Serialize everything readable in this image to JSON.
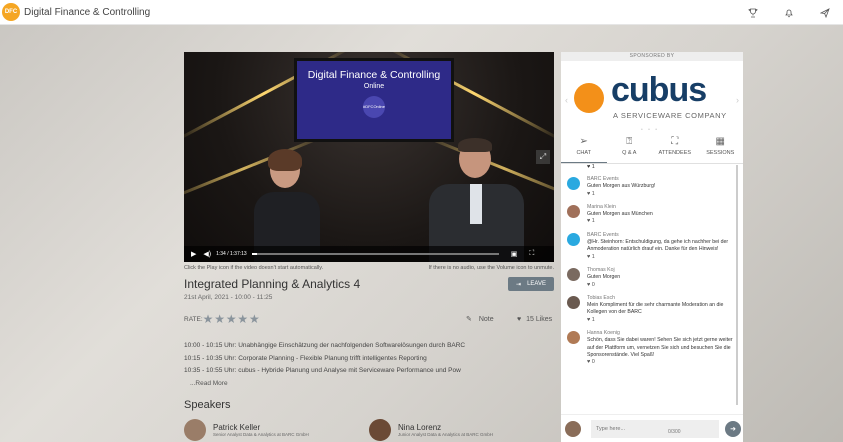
{
  "app": {
    "title": "Digital Finance & Controlling",
    "logo_text": "DFC"
  },
  "top_icons": [
    "trophy-icon",
    "bell-icon",
    "paper-plane-icon"
  ],
  "video": {
    "screen_title": "Digital Finance & Controlling",
    "screen_subtitle": "Online",
    "screen_tag": "#DFCOnline",
    "time": "1:34 / 1:37:13"
  },
  "hints": {
    "play": "Click the Play icon if the video doesn't start automatically.",
    "audio": "If there is no audio, use the Volume icon to unmute."
  },
  "session": {
    "title": "Integrated Planning & Analytics 4",
    "date": "21st April, 2021 - 10:00 - 11:25",
    "leave_label": "LEAVE",
    "rate_label": "RATE:",
    "stars": [
      "★",
      "★",
      "★",
      "★",
      "★"
    ],
    "note_label": "Note",
    "likes_label": "15 Likes"
  },
  "agenda": [
    "10:00 - 10:15 Uhr: Unabhängige Einschätzung der nachfolgenden Softwarelösungen durch BARC",
    "10:15 - 10:35 Uhr: Corporate Planning - Flexible Planung trifft intelligentes Reporting",
    "10:35 - 10:55 Uhr: cubus - Hybride Planung und Analyse mit Serviceware Performance und Pow"
  ],
  "read_more": "...Read More",
  "speakers": {
    "heading": "Speakers",
    "items": [
      {
        "name": "Patrick Keller",
        "role": "Senior Analyst Data & Analytics at BARC GmbH"
      },
      {
        "name": "Nina Lorenz",
        "role": "Junior Analyst Data & Analytics at BARC GmbH"
      }
    ]
  },
  "sponsor": {
    "label": "SPONSORED BY",
    "brand": "cubus",
    "subtitle": "A SERVICEWARE COMPANY",
    "dots": "• • •"
  },
  "tabs": [
    {
      "label": "CHAT",
      "icon": "paper-plane-icon"
    },
    {
      "label": "Q & A",
      "icon": "question-icon"
    },
    {
      "label": "ATTENDEES",
      "icon": "attendees-icon"
    },
    {
      "label": "SESSIONS",
      "icon": "calendar-icon"
    }
  ],
  "chat": {
    "first_like": "♥ 1",
    "messages": [
      {
        "name": "BARC Events",
        "text": "Guten Morgen aus Würzburg!",
        "likes": "♥ 1",
        "avatar_color": "#2aa9e0"
      },
      {
        "name": "Marina Klein",
        "text": "Guten Morgen aus München",
        "likes": "♥ 1",
        "avatar_color": "#a0705a"
      },
      {
        "name": "BARC Events",
        "text": "@Hr. Steinhorn: Entschuldigung, da gehe ich nachher bei der Anmoderation natürlich drauf ein. Danke für den Hinweis!",
        "likes": "♥ 1",
        "avatar_color": "#2aa9e0"
      },
      {
        "name": "Thomas Koj",
        "text": "Guten Morgen",
        "likes": "♥ 0",
        "avatar_color": "#7a6a60"
      },
      {
        "name": "Tobias Esch",
        "text": "Mein Kompliment für die sehr charmante Moderation an die Kollegen von der BARC",
        "likes": "♥ 1",
        "avatar_color": "#6a5a50"
      },
      {
        "name": "Hanna Koenig",
        "text": "Schön, dass Sie dabei waren! Sehen Sie sich jetzt gerne weiter auf der Plattform um, vernetzen Sie sich und besuchen Sie die Sponsorenstände. Viel Spaß!",
        "likes": "♥ 0",
        "avatar_color": "#b07a55"
      }
    ],
    "input_placeholder": "Type here...",
    "counter": "0/300"
  }
}
